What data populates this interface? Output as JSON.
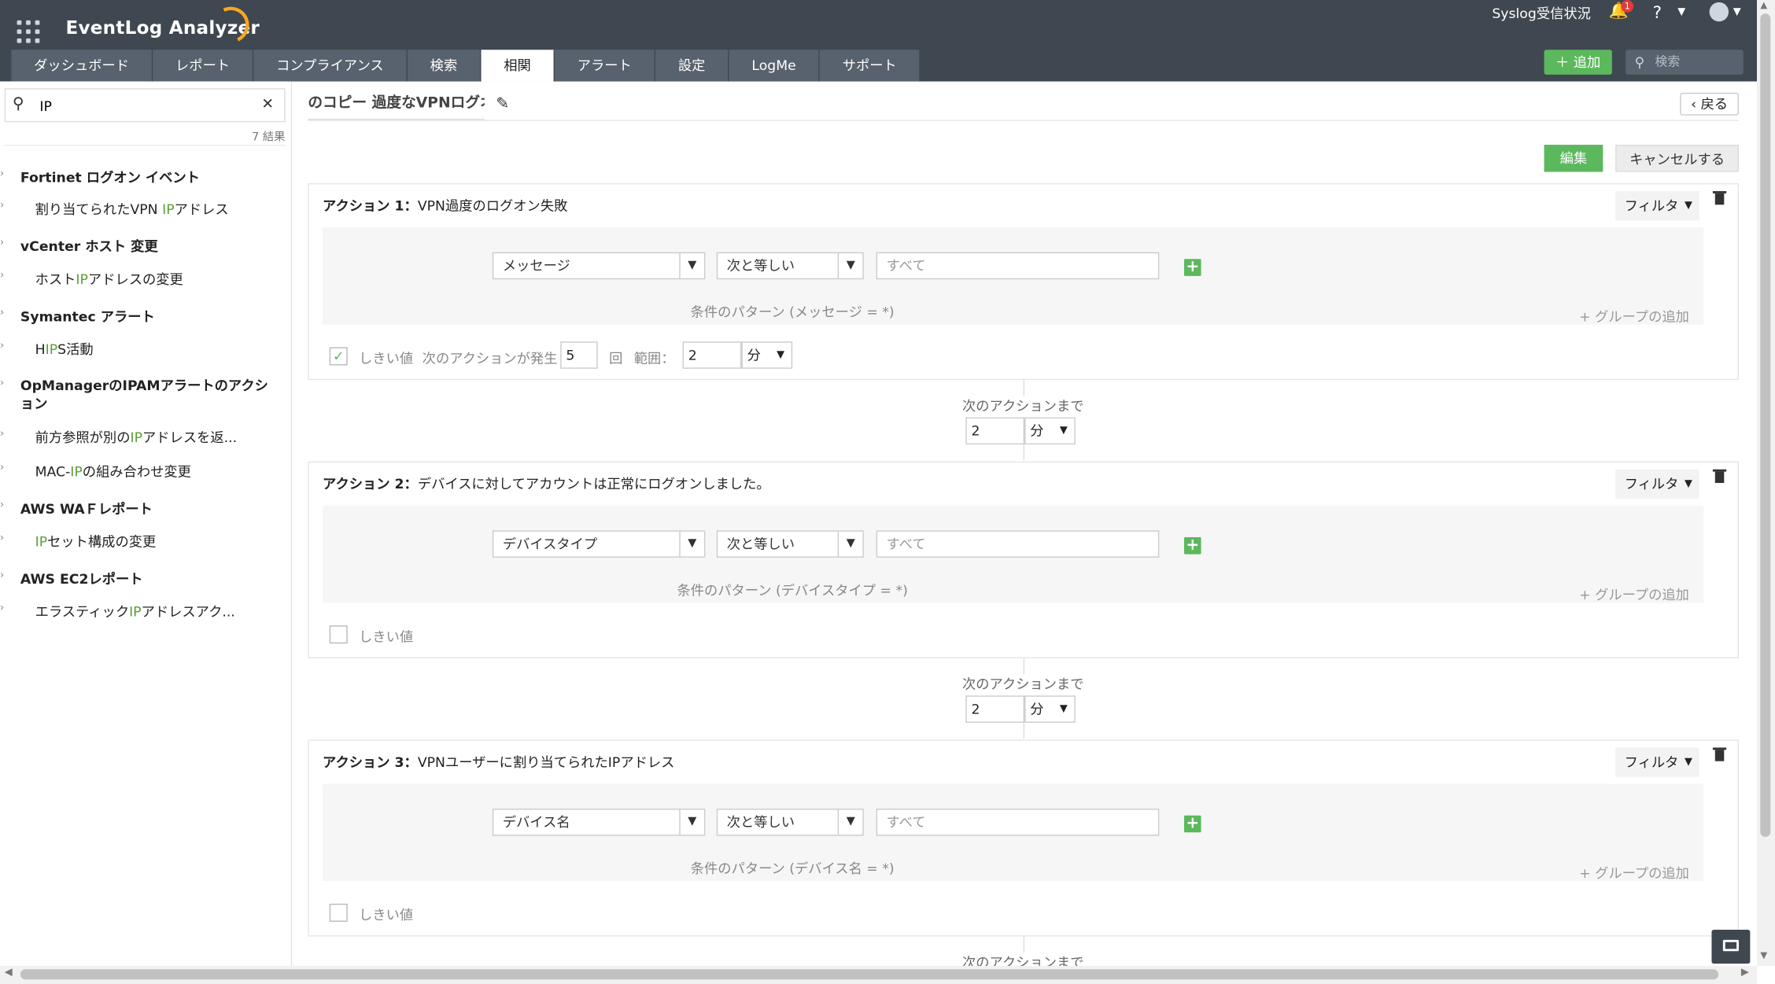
{
  "header": {
    "app_title": "EventLog Analyzer",
    "syslog_status": "Syslog受信状況",
    "notification_count": "1",
    "help": "?",
    "add_button": "＋ 追加",
    "search_placeholder": "検索"
  },
  "nav": {
    "tabs": [
      {
        "label": "ダッシュボード"
      },
      {
        "label": "レポート"
      },
      {
        "label": "コンプライアンス"
      },
      {
        "label": "検索"
      },
      {
        "label": "相関"
      },
      {
        "label": "アラート"
      },
      {
        "label": "設定"
      },
      {
        "label": "LogMe"
      },
      {
        "label": "サポート"
      }
    ],
    "active_tab": "相関"
  },
  "sidebar": {
    "search_value": "IP",
    "result_count": "7 結果",
    "groups": [
      {
        "title": "Fortinet ログオン イベント",
        "items": [
          {
            "pre": "割り当てられたVPN ",
            "hl": "IP",
            "post": "アドレス"
          }
        ]
      },
      {
        "title": "vCenter ホスト 変更",
        "items": [
          {
            "pre": "ホスト",
            "hl": "IP",
            "post": "アドレスの変更"
          }
        ]
      },
      {
        "title": "Symantec アラート",
        "items": [
          {
            "pre": "H",
            "hl": "IP",
            "post": "S活動"
          }
        ]
      },
      {
        "title": "OpManagerのIPAMアラートのアクション",
        "items": [
          {
            "pre": "前方参照が別の",
            "hl": "IP",
            "post": "アドレスを返..."
          },
          {
            "pre": "MAC-",
            "hl": "IP",
            "post": "の組み合わせ変更"
          }
        ]
      },
      {
        "title": "AWS WAＦレポート",
        "items": [
          {
            "pre": "",
            "hl": "IP",
            "post": "セット構成の変更"
          }
        ]
      },
      {
        "title": "AWS EC2レポート",
        "items": [
          {
            "pre": "エラスティック",
            "hl": "IP",
            "post": "アドレスアク..."
          }
        ]
      }
    ]
  },
  "main": {
    "rule_title": "のコピー 過度なVPNログオン",
    "back_button": "戻る",
    "edit_button": "編集",
    "cancel_button": "キャンセルする",
    "filter_label": "フィルタ",
    "add_group_label": "+ グループの追加",
    "value_placeholder": "すべて",
    "threshold_label": "しきい値",
    "next_action_label": "次のアクションまで",
    "actions": [
      {
        "label": "アクション 1：",
        "name": "VPN過度のログオン失敗",
        "field": "メッセージ",
        "operator": "次と等しい",
        "pattern": "条件のパターン (メッセージ = *)",
        "threshold_checked": true,
        "threshold": {
          "occurs_label": "次のアクションが発生",
          "count": "5",
          "times_label": "回",
          "range_label": "範囲：",
          "range": "2",
          "unit": "分"
        }
      },
      {
        "label": "アクション 2：",
        "name": "デバイスに対してアカウントは正常にログオンしました。",
        "field": "デバイスタイプ",
        "operator": "次と等しい",
        "pattern": "条件のパターン (デバイスタイプ = *)",
        "threshold_checked": false
      },
      {
        "label": "アクション 3：",
        "name": "VPNユーザーに割り当てられたIPアドレス",
        "field": "デバイス名",
        "operator": "次と等しい",
        "pattern": "条件のパターン (デバイス名 = *)",
        "threshold_checked": false
      }
    ],
    "intervals": [
      {
        "value": "2",
        "unit": "分"
      },
      {
        "value": "2",
        "unit": "分"
      }
    ]
  },
  "colors": {
    "header_bg": "#3f4750",
    "accent_green": "#5cb85c",
    "highlight_green": "#5a9e36",
    "alert_orange": "#f5a623"
  }
}
